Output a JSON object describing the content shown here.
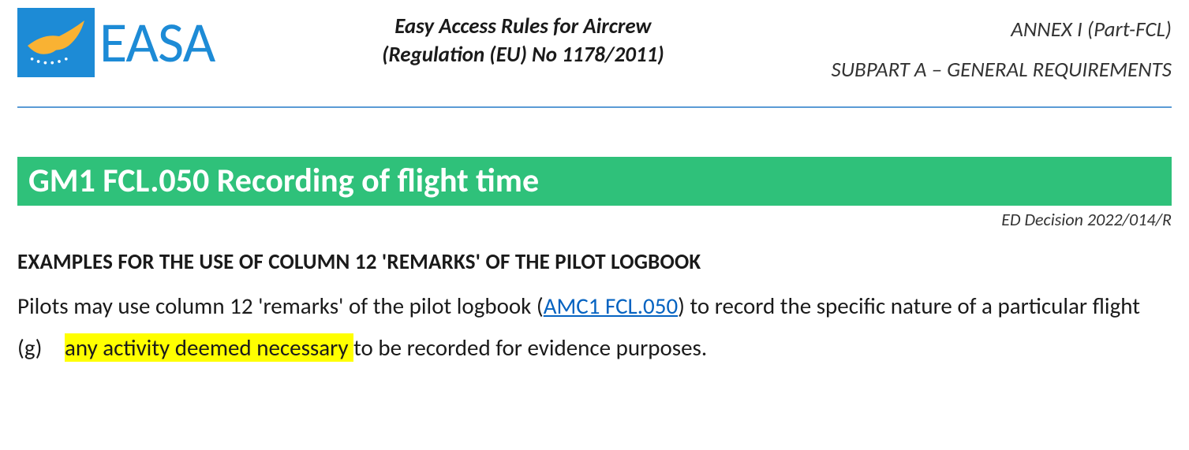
{
  "logo": {
    "text": "EASA",
    "icon_name": "easa-bird-icon"
  },
  "header": {
    "center_line1": "Easy Access Rules for Aircrew",
    "center_line2": "(Regulation (EU) No 1178/2011)",
    "right_line1": "ANNEX I (Part-FCL)",
    "right_line2": "SUBPART A – GENERAL REQUIREMENTS"
  },
  "title_banner": "GM1 FCL.050 Recording of flight time",
  "decision": "ED Decision 2022/014/R",
  "sub_heading": "EXAMPLES FOR THE USE OF COLUMN 12 'REMARKS' OF THE PILOT LOGBOOK",
  "intro": {
    "before_link": "Pilots may use column 12 'remarks' of the pilot logbook (",
    "link_text": "AMC1 FCL.050",
    "after_link": ") to record the specific nature of a particular flight"
  },
  "item_g": {
    "marker": "(g)",
    "highlight": "any activity deemed necessary ",
    "rest": "to be recorded for evidence purposes."
  }
}
